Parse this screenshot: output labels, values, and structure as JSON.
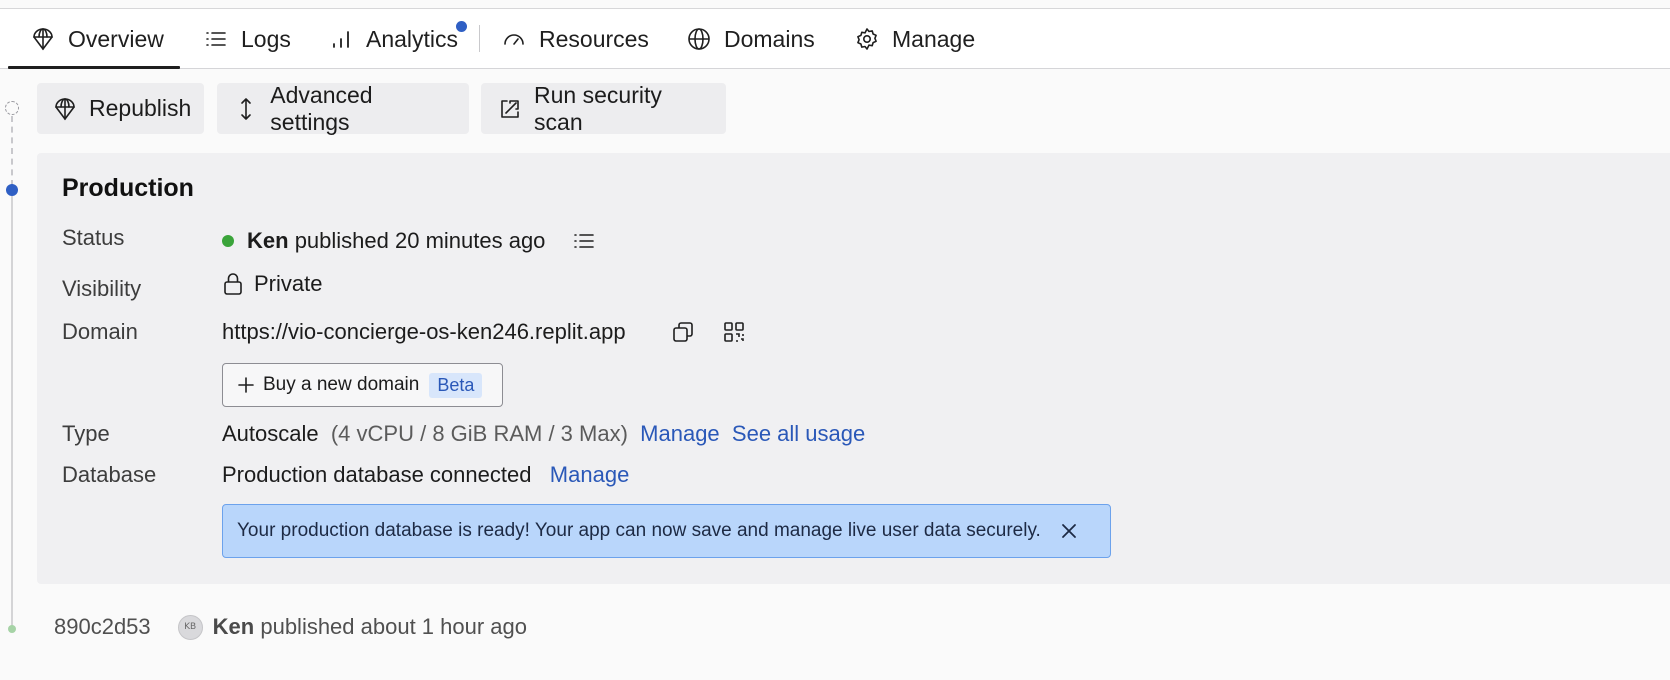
{
  "tabs": [
    {
      "label": "Overview",
      "icon": "deploy-icon",
      "active": true
    },
    {
      "label": "Logs",
      "icon": "list-icon"
    },
    {
      "label": "Analytics",
      "icon": "bar-chart-icon",
      "has_notification": true
    },
    {
      "label": "Resources",
      "icon": "gauge-icon"
    },
    {
      "label": "Domains",
      "icon": "globe-icon"
    },
    {
      "label": "Manage",
      "icon": "gear-icon"
    }
  ],
  "actions": {
    "republish": "Republish",
    "advanced_settings": "Advanced settings",
    "security_scan": "Run security scan"
  },
  "production": {
    "title": "Production",
    "status": {
      "label": "Status",
      "user": "Ken",
      "text": "published 20 minutes ago",
      "color": "#3aa43a"
    },
    "visibility": {
      "label": "Visibility",
      "value": "Private"
    },
    "domain": {
      "label": "Domain",
      "url": "https://vio-concierge-os-ken246.replit.app",
      "buy_label": "Buy a new domain",
      "buy_badge": "Beta"
    },
    "type": {
      "label": "Type",
      "value": "Autoscale",
      "spec": "(4 vCPU / 8 GiB RAM / 3 Max)",
      "manage_link": "Manage",
      "usage_link": "See all usage"
    },
    "database": {
      "label": "Database",
      "value": "Production database connected",
      "manage_link": "Manage"
    },
    "banner": "Your production database is ready! Your app can now save and manage live user data securely."
  },
  "history": [
    {
      "commit": "890c2d53",
      "avatar_initials": "KB",
      "user": "Ken",
      "text": "published about 1 hour ago"
    }
  ],
  "colors": {
    "accent": "#2f5fc4",
    "link": "#2a58b8",
    "banner_bg": "#b9d6fb",
    "card_bg": "#f0f0f2"
  }
}
